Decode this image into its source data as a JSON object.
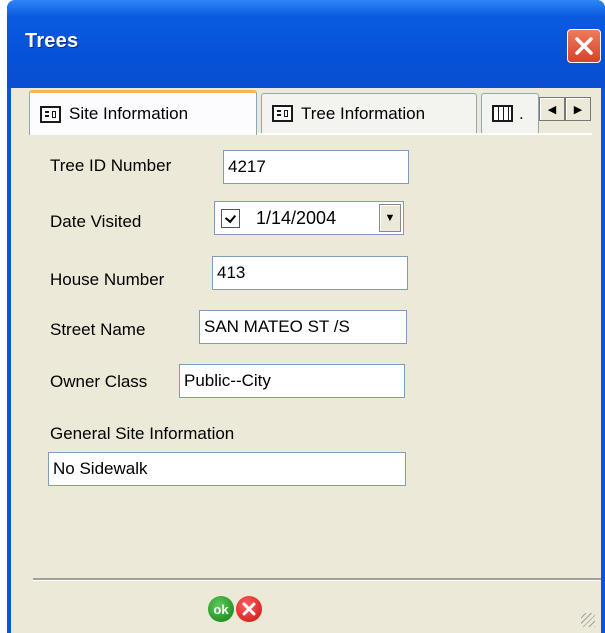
{
  "window": {
    "title": "Trees"
  },
  "tabs": [
    {
      "label": "Site Information",
      "icon": "form-icon",
      "active": true
    },
    {
      "label": "Tree Information",
      "icon": "form-icon",
      "active": false
    },
    {
      "label": ".",
      "icon": "table-icon",
      "active": false
    }
  ],
  "fields": {
    "tree_id": {
      "label": "Tree ID Number",
      "value": "4217"
    },
    "date_visited": {
      "label": "Date Visited",
      "value": "1/14/2004",
      "checked": true
    },
    "house_number": {
      "label": "House Number",
      "value": "413"
    },
    "street_name": {
      "label": "Street Name",
      "value": "SAN MATEO ST /S"
    },
    "owner_class": {
      "label": "Owner Class",
      "value": "Public--City"
    },
    "general_site_info": {
      "label": "General Site Information",
      "value": "No Sidewalk"
    }
  },
  "buttons": {
    "ok_label": "ok"
  },
  "colors": {
    "titlebar": "#0553d8",
    "client_bg": "#ece9d8",
    "close": "#d9432a",
    "ok": "#108010",
    "cancel": "#c81010"
  }
}
